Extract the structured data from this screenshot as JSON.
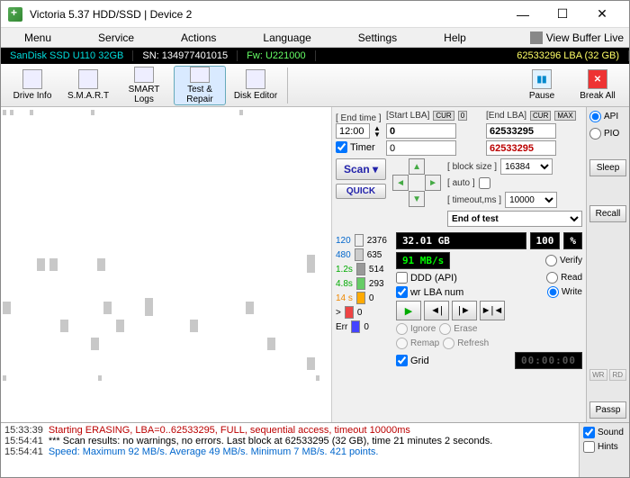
{
  "window": {
    "title": "Victoria 5.37 HDD/SSD | Device 2"
  },
  "menu": {
    "items": [
      "Menu",
      "Service",
      "Actions",
      "Language",
      "Settings",
      "Help"
    ],
    "right": "View Buffer Live"
  },
  "infobar": {
    "device": "SanDisk SSD U110 32GB",
    "sn": "SN: 134977401015",
    "fw": "Fw: U221000",
    "lba": "62533296 LBA (32 GB)"
  },
  "toolbar": {
    "drive_info": "Drive Info",
    "smart": "S.M.A.R.T",
    "smart_logs": "SMART Logs",
    "test_repair": "Test & Repair",
    "disk_editor": "Disk Editor",
    "pause": "Pause",
    "break_all": "Break All"
  },
  "scan": {
    "end_time_lbl": "[ End time ]",
    "end_time": "12:00",
    "timer_lbl": "Timer",
    "start_lba_lbl": "[Start LBA]",
    "start_lba": "0",
    "start_lba_b": "0",
    "end_lba_lbl": "[End LBA]",
    "end_lba": "62533295",
    "end_lba_b": "62533295",
    "cur": "CUR",
    "zero": "0",
    "max": "MAX",
    "scan_btn": "Scan",
    "quick_btn": "QUICK",
    "block_size_lbl": "[ block size ]",
    "block_size": "16384",
    "auto_lbl": "[ auto ]",
    "timeout_lbl": "[ timeout,ms ]",
    "timeout": "10000",
    "action": "End of test"
  },
  "timings": {
    "t120": "120",
    "v120": "2376",
    "t480": "480",
    "v480": "635",
    "t1_2s": "1.2s",
    "v1_2s": "514",
    "t4_8s": "4.8s",
    "v4_8s": "293",
    "t14s": "14 s",
    "v14s": "0",
    "tgt": ">",
    "vgt": "0",
    "terr": "Err",
    "verr": "0"
  },
  "status": {
    "size": "32.01 GB",
    "pct_num": "100",
    "pct_sym": "%",
    "speed": "91 MB/s",
    "clock": "00:00:00",
    "verify": "Verify",
    "read": "Read",
    "write": "Write",
    "ddd": "DDD (API)",
    "wrlba": "wr LBA num",
    "ignore": "Ignore",
    "erase": "Erase",
    "remap": "Remap",
    "refresh": "Refresh",
    "grid": "Grid"
  },
  "sidebar": {
    "api": "API",
    "pio": "PIO",
    "sleep": "Sleep",
    "recall": "Recall",
    "passp": "Passp",
    "wr": "WR",
    "rd": "RD"
  },
  "log": {
    "r1t": "15:33:39",
    "r1": "Starting ERASING, LBA=0..62533295, FULL, sequential access, timeout 10000ms",
    "r2t": "15:54:41",
    "r2": "*** Scan results: no warnings, no errors. Last block at 62533295 (32 GB), time 21 minutes 2 seconds.",
    "r3t": "15:54:41",
    "r3": "Speed: Maximum 92 MB/s. Average 49 MB/s. Minimum 7 MB/s. 421 points.",
    "sound": "Sound",
    "hints": "Hints"
  }
}
